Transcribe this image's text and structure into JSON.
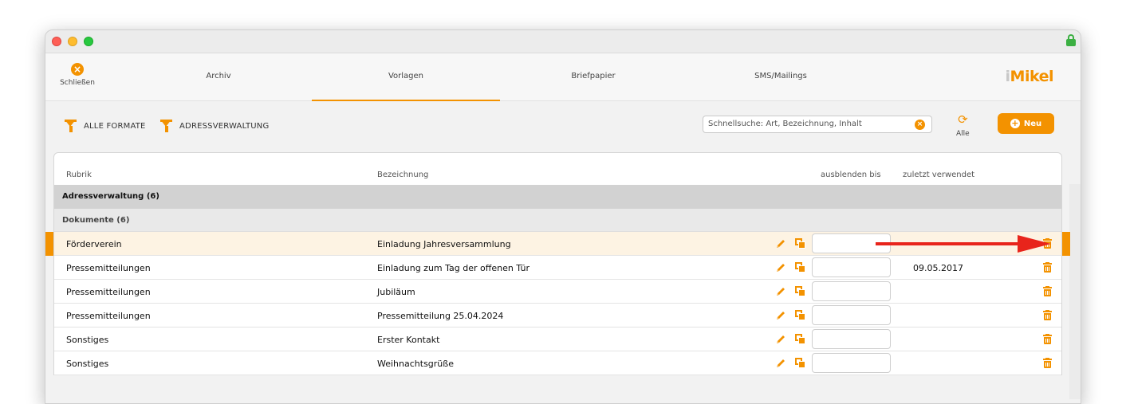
{
  "nav": {
    "close_label": "Schließen",
    "tabs": [
      {
        "label": "Archiv",
        "active": false
      },
      {
        "label": "Vorlagen",
        "active": true
      },
      {
        "label": "Briefpapier",
        "active": false
      },
      {
        "label": "SMS/Mailings",
        "active": false
      }
    ],
    "logo": {
      "prefix": "i",
      "rest": "Mikel"
    }
  },
  "filters": {
    "formats_label": "ALLE FORMATE",
    "category_label": "ADRESSVERWALTUNG"
  },
  "search": {
    "placeholder": "Schnellsuche: Art, Bezeichnung, Inhalt",
    "refresh_label": "Alle",
    "new_label": "Neu"
  },
  "table": {
    "columns": {
      "rubrik": "Rubrik",
      "bezeichnung": "Bezeichnung",
      "ausblenden": "ausblenden bis",
      "zuletzt": "zuletzt verwendet"
    },
    "group": "Adressverwaltung (6)",
    "subgroup": "Dokumente (6)",
    "rows": [
      {
        "rubrik": "Förderverein",
        "bezeichnung": "Einladung Jahresversammlung",
        "ausblenden": "",
        "zuletzt": "",
        "selected": true
      },
      {
        "rubrik": "Pressemitteilungen",
        "bezeichnung": "Einladung zum Tag der offenen Tür",
        "ausblenden": "",
        "zuletzt": "09.05.2017",
        "selected": false
      },
      {
        "rubrik": "Pressemitteilungen",
        "bezeichnung": "Jubiläum",
        "ausblenden": "",
        "zuletzt": "",
        "selected": false
      },
      {
        "rubrik": "Pressemitteilungen",
        "bezeichnung": "Pressemitteilung 25.04.2024",
        "ausblenden": "",
        "zuletzt": "",
        "selected": false
      },
      {
        "rubrik": "Sonstiges",
        "bezeichnung": "Erster Kontakt",
        "ausblenden": "",
        "zuletzt": "",
        "selected": false
      },
      {
        "rubrik": "Sonstiges",
        "bezeichnung": "Weihnachtsgrüße",
        "ausblenden": "",
        "zuletzt": "",
        "selected": false
      }
    ]
  },
  "colors": {
    "accent": "#f39200",
    "arrow": "#e8241b"
  },
  "icons": [
    "close-icon",
    "filter-icon",
    "search-clear-icon",
    "refresh-icon",
    "plus-icon",
    "edit-icon",
    "copy-icon",
    "trash-icon",
    "lock-icon"
  ]
}
